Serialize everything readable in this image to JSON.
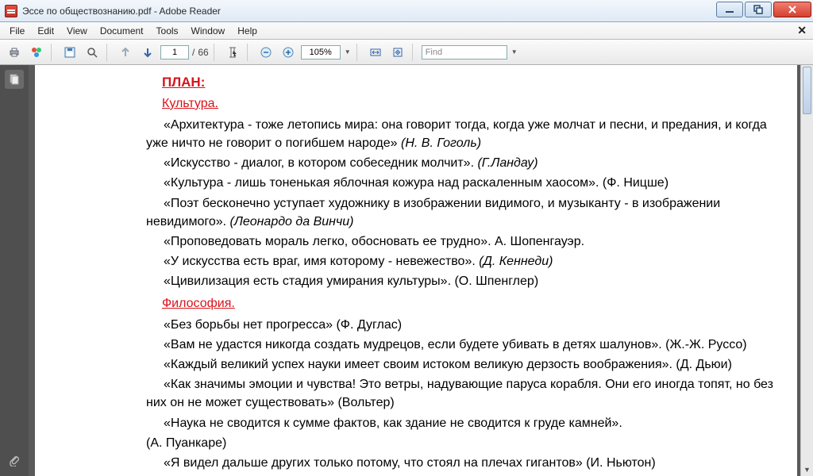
{
  "window": {
    "title": "Эссе по обществознанию.pdf - Adobe Reader"
  },
  "menu": {
    "file": "File",
    "edit": "Edit",
    "view": "View",
    "document": "Document",
    "tools": "Tools",
    "window": "Window",
    "help": "Help"
  },
  "toolbar": {
    "page_current": "1",
    "page_sep": "/",
    "page_total": "66",
    "zoom": "105%",
    "find_placeholder": "Find"
  },
  "doc": {
    "plan": "ПЛАН:",
    "section1": "Культура.",
    "p1": "«Архитектура - тоже летопись мира: она говорит тогда, когда уже молчат и песни, и предания, и когда уже ничто не говорит о погибшем народе» ",
    "p1_author": "(Н. В. Гоголь)",
    "p2": "«Искусство - диалог, в котором собеседник молчит». ",
    "p2_author": "(Г.Ландау)",
    "p3": "«Культура - лишь тоненькая яблочная кожура над раскаленным хаосом». (Ф. Ницше)",
    "p4a": "«Поэт бесконечно уступает художнику в изображении видимого, и музыканту - в изображении невидимого». ",
    "p4b": "(Леонардо да Винчи)",
    "p5": "«Проповедовать мораль легко, обосновать ее трудно».  А. Шопенгауэр.",
    "p6a": "«У искусства есть враг, имя которому - невежество». ",
    "p6b": "(Д. Кеннеди)",
    "p7": "«Цивилизация есть стадия умирания культуры». (О. Шпенглер)",
    "section2": "Философия.",
    "p8": "«Без борьбы нет прогресса» (Ф. Дуглас)",
    "p9": "«Вам не удастся никогда создать мудрецов, если будете убивать в детях шалунов». (Ж.-Ж. Руссо)",
    "p10": "«Каждый великий успех науки имеет своим истоком великую дерзость воображения». (Д. Дьюи)",
    "p11": "«Как значимы эмоции и чувства! Это ветры, надувающие паруса корабля. Они его иногда топят, но без них он не может существовать» (Вольтер)",
    "p12": "«Наука не сводится к сумме фактов, как здание не сводится к груде камней».",
    "p12b": "(А. Пуанкаре)",
    "p13": "«Я видел дальше других только потому, что стоял на плечах гигантов» (И. Ньютон)"
  }
}
